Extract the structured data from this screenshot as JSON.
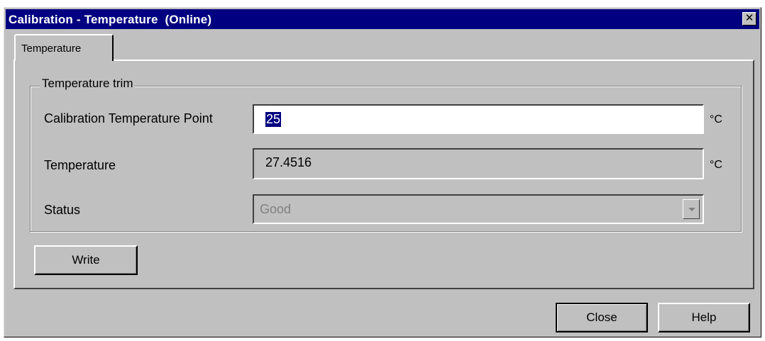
{
  "window": {
    "title": "Calibration - Temperature  (Online)",
    "close_glyph": "✕"
  },
  "tabs": [
    {
      "label": "Temperature",
      "active": true
    }
  ],
  "group": {
    "legend": "Temperature trim"
  },
  "fields": {
    "calibration_point": {
      "label": "Calibration Temperature Point",
      "value": "25",
      "unit": "°C"
    },
    "temperature": {
      "label": "Temperature",
      "value": "27.4516",
      "unit": "°C"
    },
    "status": {
      "label": "Status",
      "value": "Good"
    }
  },
  "buttons": {
    "write": "Write",
    "close": "Close",
    "help": "Help"
  },
  "colors": {
    "titlebar": "#000080",
    "face": "#c0c0c0",
    "selection": "#000080"
  }
}
